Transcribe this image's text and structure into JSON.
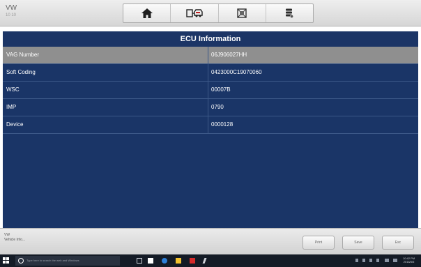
{
  "header": {
    "vehicle_make": "VW",
    "vehicle_sub": "10 10",
    "toolbar": [
      {
        "name": "home-icon"
      },
      {
        "name": "vehicle-swap-icon"
      },
      {
        "name": "screenshot-icon"
      },
      {
        "name": "data-logging-icon"
      }
    ]
  },
  "title": "ECU Information",
  "rows": [
    {
      "label": "VAG Number",
      "value": "06J906027HH",
      "selected": true
    },
    {
      "label": "Soft Coding",
      "value": "0423000C19070060",
      "selected": false
    },
    {
      "label": "WSC",
      "value": "00007B",
      "selected": false
    },
    {
      "label": "IMP",
      "value": "0790",
      "selected": false
    },
    {
      "label": "Device",
      "value": "0000128",
      "selected": false
    }
  ],
  "status": {
    "line1": "VW",
    "line2": "Vehicle Info..."
  },
  "buttons": {
    "print": "Print",
    "save": "Save",
    "esc": "Esc"
  },
  "taskbar": {
    "search_placeholder": "Type here to search the web and Windows",
    "clock_time": "10:42 PM",
    "clock_date": "2016/5/5"
  },
  "colors": {
    "panel": "#1a3567",
    "title": "#1c3566",
    "selected_row": "#8f8f8f",
    "taskbar": "#141b26"
  }
}
